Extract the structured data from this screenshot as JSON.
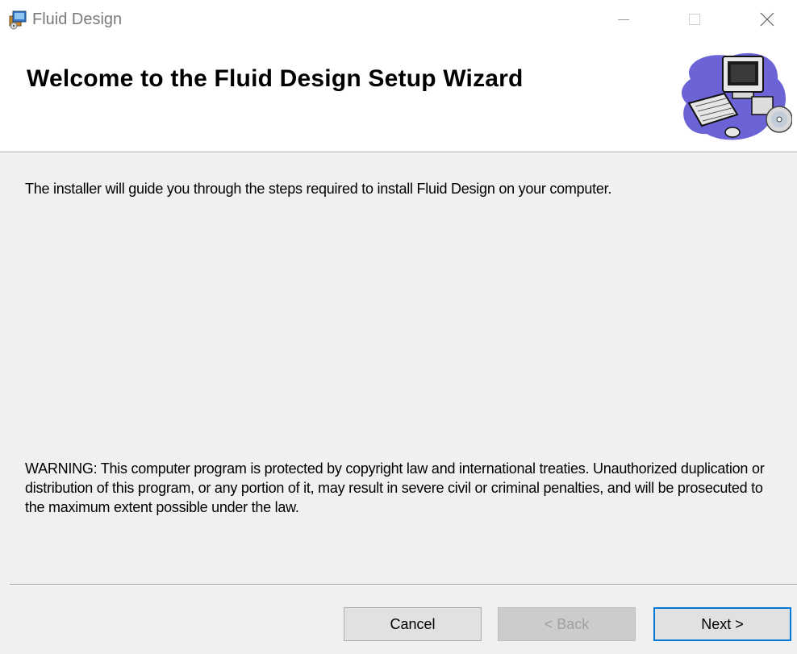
{
  "window": {
    "title": "Fluid Design",
    "app_icon": "installer-icon",
    "controls": {
      "minimize": "minimize-icon",
      "maximize": "maximize-icon",
      "close": "close-icon"
    }
  },
  "banner": {
    "title": "Welcome to the Fluid Design Setup Wizard",
    "graphic": "computer-setup-graphic"
  },
  "body": {
    "intro": "The installer will guide you through the steps required to install Fluid Design on your computer.",
    "warning": "WARNING: This computer program is protected by copyright law and international treaties. Unauthorized duplication or distribution of this program, or any portion of it, may result in severe civil or criminal penalties, and will be prosecuted to the maximum extent possible under the law."
  },
  "buttons": {
    "cancel": "Cancel",
    "back": "< Back",
    "next": "Next >"
  },
  "colors": {
    "accent": "#0078d7",
    "background": "#f0f0f0",
    "banner": "#ffffff"
  }
}
